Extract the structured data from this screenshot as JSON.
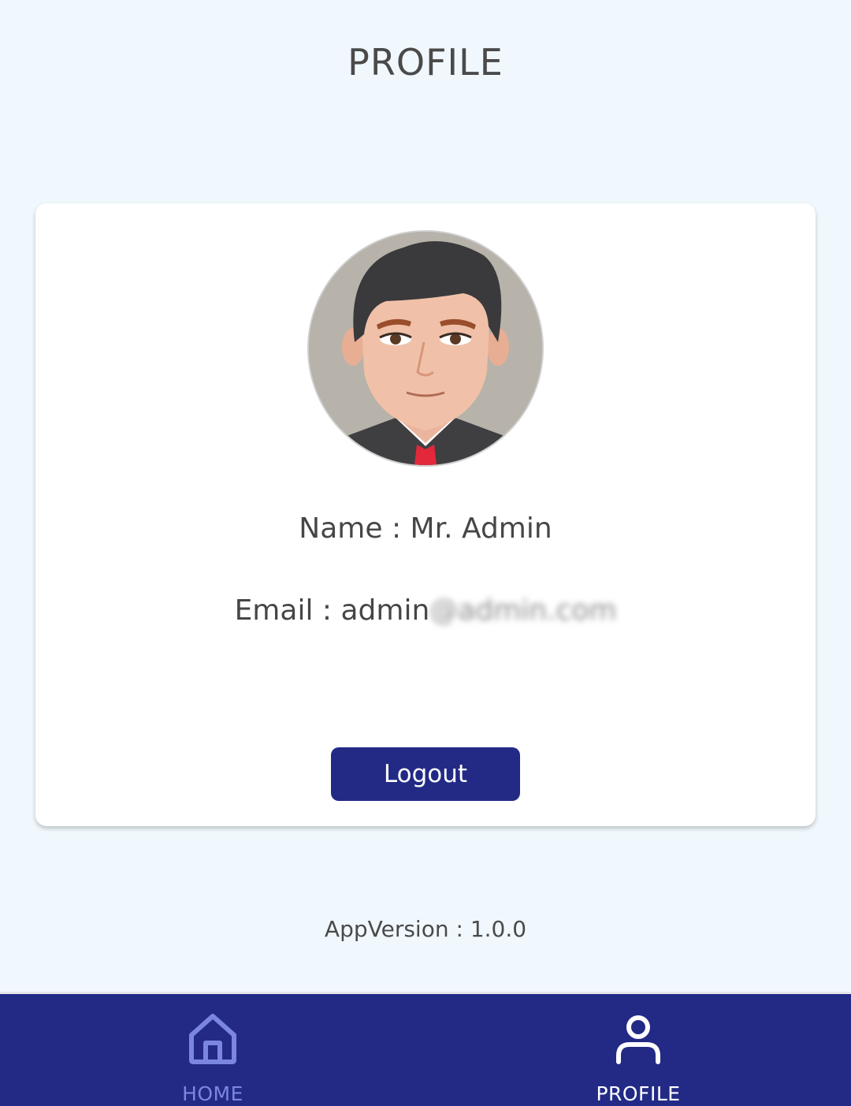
{
  "header": {
    "title": "PROFILE"
  },
  "profile": {
    "avatar": "male-avatar-cartoon",
    "name_line": "Name : Mr. Admin",
    "email_label": "Email : ",
    "email_visible": "admin",
    "email_obscured": "@admin.com",
    "logout_label": "Logout"
  },
  "footer": {
    "app_version": "AppVersion : 1.0.0"
  },
  "bottom_nav": {
    "items": [
      {
        "label": "HOME",
        "icon": "home-icon",
        "active": false
      },
      {
        "label": "PROFILE",
        "icon": "person-icon",
        "active": true
      }
    ]
  },
  "colors": {
    "background": "#f1f8fd",
    "card": "#ffffff",
    "primary": "#222a86",
    "inactive_nav": "#7b86e0",
    "text": "#464646"
  }
}
